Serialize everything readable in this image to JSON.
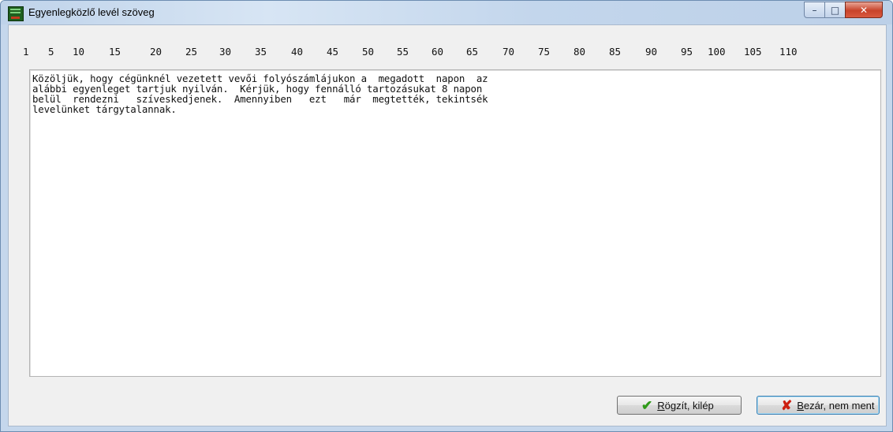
{
  "window": {
    "title": "Egyenlegközlő levél szöveg",
    "controls": {
      "minimize_icon": "minimize-icon",
      "maximize_icon": "maximize-icon",
      "close_icon": "close-icon"
    }
  },
  "ruler": {
    "ticks": [
      "1",
      "5",
      "10",
      "15",
      "20",
      "25",
      "30",
      "35",
      "40",
      "45",
      "50",
      "55",
      "60",
      "65",
      "70",
      "75",
      "80",
      "85",
      "90",
      "95",
      "100",
      "105",
      "110"
    ]
  },
  "editor": {
    "lines": [
      "Közöljük, hogy cégünknél vezetett vevői folyószámlájukon a  megadott  napon  az",
      "alábbi egyenleget tartjuk nyilván.  Kérjük, hogy fennálló tartozásukat 8 napon",
      "belül  rendezni   szíveskedjenek.  Amennyiben   ezt   már  megtették, tekintsék",
      "levelünket tárgytalannak."
    ]
  },
  "buttons": {
    "save": {
      "label": "Rögzít, kilép",
      "icon": "checkmark-icon"
    },
    "close": {
      "label": "Bezár, nem ment",
      "icon": "x-icon"
    }
  },
  "colors": {
    "save_icon": "#2f9a19",
    "close_icon": "#cc1f10",
    "title_bar": "#c6d8ec"
  }
}
